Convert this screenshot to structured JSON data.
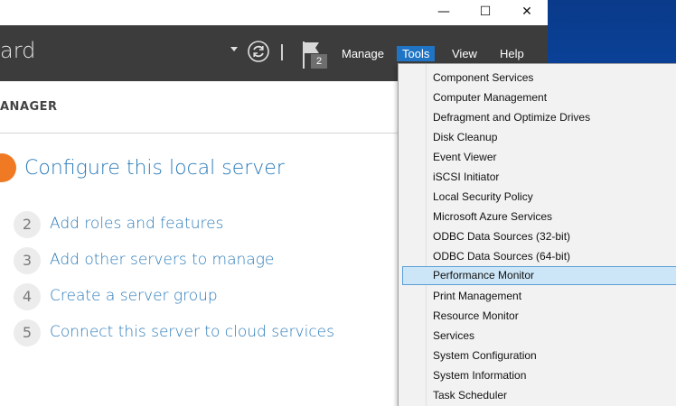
{
  "window": {
    "minimize_glyph": "—",
    "maximize_glyph": "☐",
    "close_glyph": "✕"
  },
  "header": {
    "title_fragment": "ard",
    "notifications_count": "2",
    "menu": {
      "manage": "Manage",
      "tools": "Tools",
      "view": "View",
      "help": "Help"
    }
  },
  "subheader": {
    "label": "ANAGER"
  },
  "quick_start": {
    "step1": "Configure this local server",
    "steps": [
      {
        "num": "2",
        "label": "Add roles and features"
      },
      {
        "num": "3",
        "label": "Add other servers to manage"
      },
      {
        "num": "4",
        "label": "Create a server group"
      },
      {
        "num": "5",
        "label": "Connect this server to cloud services"
      }
    ]
  },
  "tools_menu": {
    "highlighted": "Performance Monitor",
    "items": [
      "Component Services",
      "Computer Management",
      "Defragment and Optimize Drives",
      "Disk Cleanup",
      "Event Viewer",
      "iSCSI Initiator",
      "Local Security Policy",
      "Microsoft Azure Services",
      "ODBC Data Sources (32-bit)",
      "ODBC Data Sources (64-bit)",
      "Performance Monitor",
      "Print Management",
      "Resource Monitor",
      "Services",
      "System Configuration",
      "System Information",
      "Task Scheduler"
    ]
  },
  "colors": {
    "header_bg": "#3c3c3c",
    "accent_blue": "#1f74c4",
    "link_blue": "#2a7ab8",
    "step1_orange": "#f07a24",
    "highlight_bg": "#cde6f7"
  }
}
